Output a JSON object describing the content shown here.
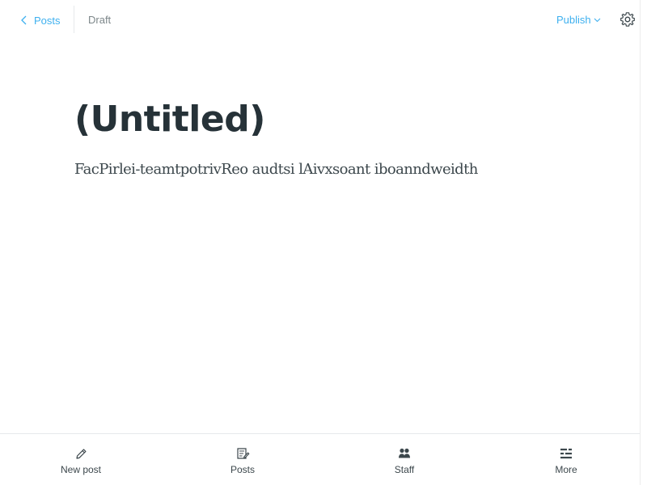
{
  "header": {
    "back_label": "Posts",
    "status": "Draft",
    "publish_label": "Publish"
  },
  "editor": {
    "title": "(Untitled)",
    "body": "FacPirlei-teamtpotrivReo audtsi lAivxsoant iboanndweidth"
  },
  "bottom_nav": {
    "items": [
      {
        "label": "New post",
        "icon": "pencil-icon"
      },
      {
        "label": "Posts",
        "icon": "posts-icon"
      },
      {
        "label": "Staff",
        "icon": "staff-icon"
      },
      {
        "label": "More",
        "icon": "more-icon"
      }
    ]
  },
  "colors": {
    "accent": "#3eb0ef",
    "title": "#263238",
    "muted": "#7d878a",
    "border": "#e6e9eb"
  }
}
